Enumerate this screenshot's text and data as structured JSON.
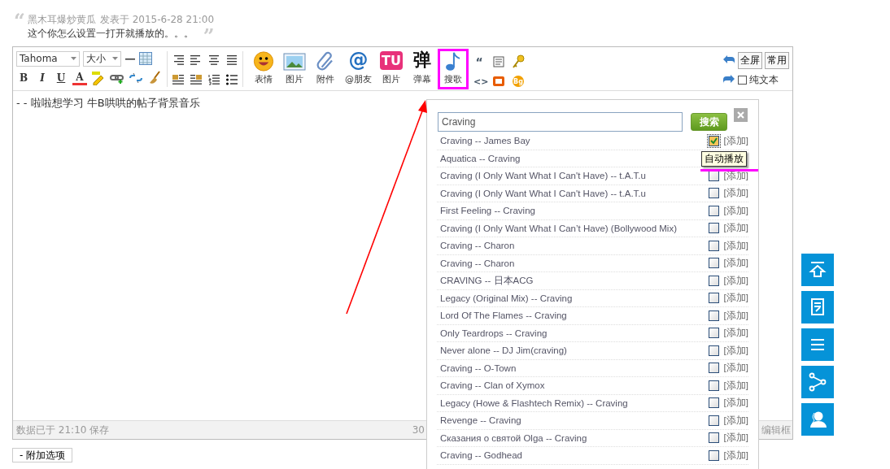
{
  "post": {
    "quote_open": "“",
    "author": "黑木耳爆炒黄瓜",
    "posted": "发表于 2015-6-28 21:00",
    "body": "这个你怎么设置一打开就播放的。。。",
    "quote_close": "”"
  },
  "editor": {
    "font": "Tahoma",
    "size": "大小",
    "format_buttons": [
      "B",
      "I",
      "U",
      "A"
    ],
    "insert_buttons": [
      {
        "label": "表情",
        "kind": "smiley",
        "selected": false
      },
      {
        "label": "图片",
        "kind": "image",
        "selected": false
      },
      {
        "label": "附件",
        "kind": "clip",
        "selected": false
      },
      {
        "label": "@朋友",
        "kind": "glyph",
        "glyph": "@",
        "selected": false
      },
      {
        "label": "图片",
        "kind": "tile",
        "glyph": "TU",
        "selected": false
      },
      {
        "label": "弹幕",
        "kind": "glyph",
        "glyph": "弹",
        "selected": false
      },
      {
        "label": "搜歌",
        "kind": "music",
        "selected": true
      }
    ],
    "quote_tool": "“",
    "code_tool": "<>",
    "bg_tool": "Bg",
    "right_buttons": [
      "全屏",
      "常用"
    ],
    "plain_text": {
      "label": "纯文本",
      "checked": false
    },
    "content": "- - 啦啦想学习  牛B哄哄的帖子背景音乐",
    "status": "数据已于 21:10 保存",
    "status_count": "30",
    "resize_label": "编辑框"
  },
  "extra_options": "- 附加选项",
  "song_search": {
    "query": "Craving",
    "button": "搜索",
    "tooltip": "自动播放",
    "songs": [
      {
        "title": "Craving -- James Bay",
        "autoplay": true,
        "action": "[添加]"
      },
      {
        "title": "Aquatica -- Craving"
      },
      {
        "title": "Craving (I Only Want What I Can't Have) -- t.A.T.u",
        "autoplay": false,
        "action": "[添加]"
      },
      {
        "title": "Craving (I Only Want What I Can't Have) -- t.A.T.u",
        "autoplay": false,
        "action": "[添加]"
      },
      {
        "title": "First Feeling -- Craving",
        "autoplay": false,
        "action": "[添加]"
      },
      {
        "title": "Craving (I Only Want What I Can’t Have) (Bollywood Mix)",
        "autoplay": false,
        "action": "[添加]"
      },
      {
        "title": "Craving -- Charon",
        "autoplay": false,
        "action": "[添加]"
      },
      {
        "title": "Craving -- Charon",
        "autoplay": false,
        "action": "[添加]"
      },
      {
        "title": "CRAVING -- 日本ACG",
        "autoplay": false,
        "action": "[添加]"
      },
      {
        "title": "Legacy (Original Mix) -- Craving",
        "autoplay": false,
        "action": "[添加]"
      },
      {
        "title": "Lord Of The Flames -- Craving",
        "autoplay": false,
        "action": "[添加]"
      },
      {
        "title": "Only Teardrops -- Craving",
        "autoplay": false,
        "action": "[添加]"
      },
      {
        "title": "Never alone -- DJ Jim(craving)",
        "autoplay": false,
        "action": "[添加]"
      },
      {
        "title": "Craving -- O-Town",
        "autoplay": false,
        "action": "[添加]"
      },
      {
        "title": "Craving -- Clan of Xymox",
        "autoplay": false,
        "action": "[添加]"
      },
      {
        "title": "Legacy (Howe & Flashtech Remix) -- Craving",
        "autoplay": false,
        "action": "[添加]"
      },
      {
        "title": "Revenge -- Craving",
        "autoplay": false,
        "action": "[添加]"
      },
      {
        "title": "Сказания о святой Olga -- Craving",
        "autoplay": false,
        "action": "[添加]"
      },
      {
        "title": "Craving -- Godhead",
        "autoplay": false,
        "action": "[添加]"
      }
    ]
  }
}
